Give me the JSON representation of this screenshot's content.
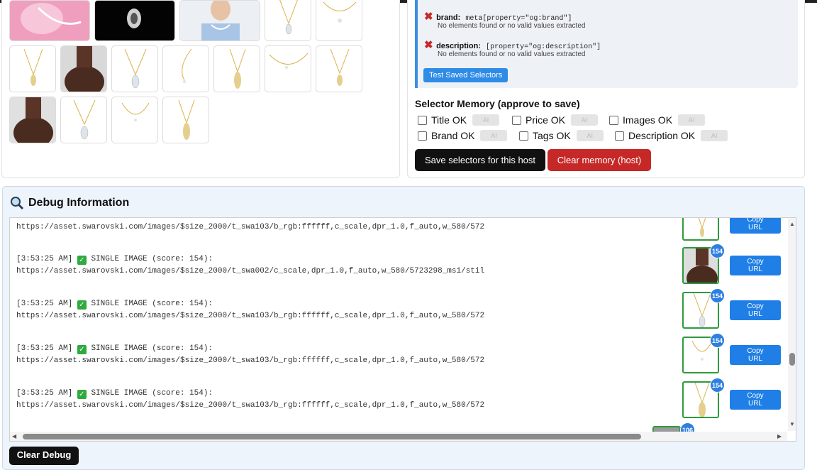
{
  "saved_selectors": {
    "rows": [
      {
        "key": "brand:",
        "selector": "meta[property=\"og:brand\"]",
        "message": "No elements found or no valid values extracted"
      },
      {
        "key": "description:",
        "selector": "[property=\"og:description\"]",
        "message": "No elements found or no valid values extracted"
      }
    ],
    "test_button": "Test Saved Selectors"
  },
  "selector_memory": {
    "title": "Selector Memory (approve to save)",
    "items": [
      {
        "label": "Title OK",
        "checked": false
      },
      {
        "label": "Price OK",
        "checked": false
      },
      {
        "label": "Images OK",
        "checked": false
      },
      {
        "label": "Brand OK",
        "checked": false
      },
      {
        "label": "Tags OK",
        "checked": false
      },
      {
        "label": "Description OK",
        "checked": false
      }
    ],
    "ai_label": "AI",
    "save_button": "Save selectors for this host",
    "clear_button": "Clear memory (host)"
  },
  "debug": {
    "title": "Debug Information",
    "partial_url": "https://asset.swarovski.com/images/$size_2000/t_swa103/b_rgb:ffffff,c_scale,dpr_1.0,f_auto,w_580/572",
    "entries": [
      {
        "time": "[3:53:25 AM]",
        "text": "SINGLE IMAGE (score: 154):",
        "url": "https://asset.swarovski.com/images/$size_2000/t_swa002/c_scale,dpr_1.0,f_auto,w_580/5723298_ms1/stil",
        "score": "154"
      },
      {
        "time": "[3:53:25 AM]",
        "text": "SINGLE IMAGE (score: 154):",
        "url": "https://asset.swarovski.com/images/$size_2000/t_swa103/b_rgb:ffffff,c_scale,dpr_1.0,f_auto,w_580/572",
        "score": "154"
      },
      {
        "time": "[3:53:25 AM]",
        "text": "SINGLE IMAGE (score: 154):",
        "url": "https://asset.swarovski.com/images/$size_2000/t_swa103/b_rgb:ffffff,c_scale,dpr_1.0,f_auto,w_580/572",
        "score": "154"
      },
      {
        "time": "[3:53:25 AM]",
        "text": "SINGLE IMAGE (score: 154):",
        "url": "https://asset.swarovski.com/images/$size_2000/t_swa103/b_rgb:ffffff,c_scale,dpr_1.0,f_auto,w_580/572",
        "score": "154"
      }
    ],
    "last_score": "106",
    "copy_label_1": "Copy",
    "copy_label_2": "URL",
    "clear_button": "Clear Debug"
  },
  "colors": {
    "accent": "#2e7fe0",
    "danger": "#c62828",
    "success": "#2eaa3e"
  }
}
